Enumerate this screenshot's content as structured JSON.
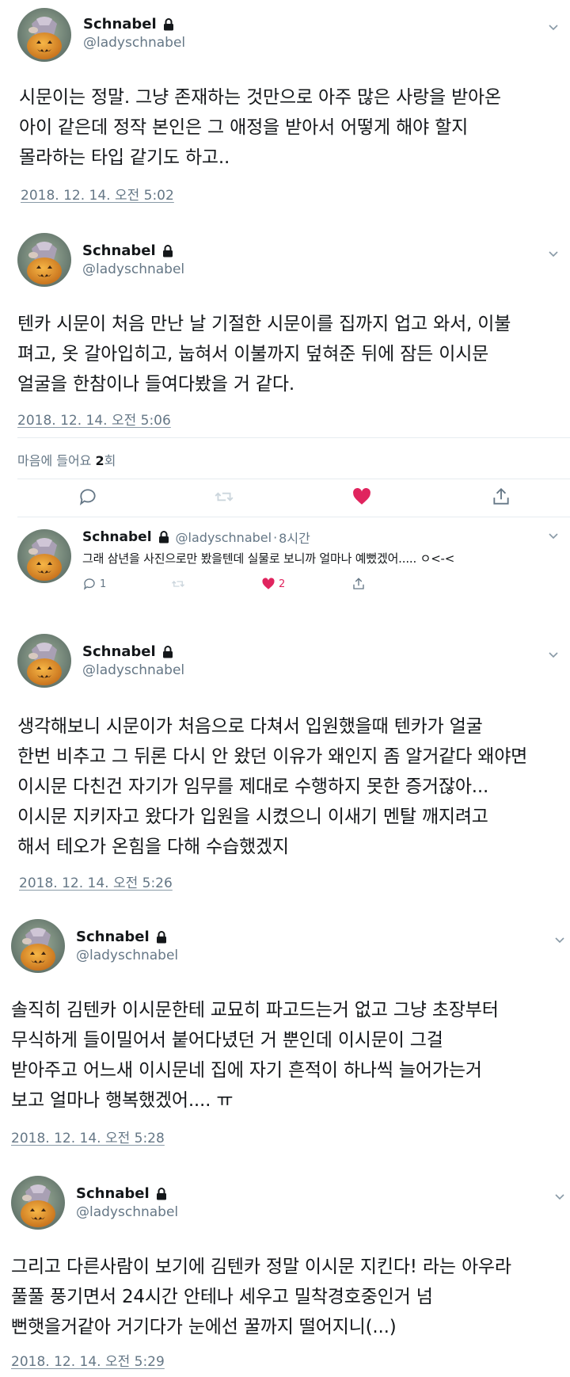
{
  "colors": {
    "text": "#14171a",
    "muted": "#657786",
    "like": "#e0245e",
    "divider": "#e6ecf0"
  },
  "tweets": [
    {
      "name": "Schnabel",
      "handle": "@ladyschnabel",
      "text": "시문이는 정말. 그냥 존재하는 것만으로 아주 많은 사랑을 받아온\n아이 같은데 정작 본인은 그 애정을 받아서 어떻게 해야 할지\n몰라하는 타입 같기도 하고..",
      "timestamp": "2018. 12. 14. 오전 5:02"
    },
    {
      "name": "Schnabel",
      "handle": "@ladyschnabel",
      "text": "텐카 시문이 처음 만난 날 기절한 시문이를 집까지 업고 와서, 이불\n펴고, 옷 갈아입히고, 눕혀서 이불까지 덮혀준 뒤에 잠든 이시문\n얼굴을 한참이나 들여다봤을 거 같다.",
      "timestamp": "2018. 12. 14. 오전 5:06",
      "likes_prefix": "마음에 들어요",
      "likes_count": "2",
      "likes_suffix": "회"
    },
    {
      "name": "Schnabel",
      "handle": "@ladyschnabel",
      "text": "생각해보니 시문이가 처음으로 다쳐서 입원했을때 텐카가 얼굴\n한번 비추고 그 뒤론 다시 안 왔던 이유가 왜인지 좀 알거같다 왜야면\n이시문 다친건 자기가 임무를 제대로 수행하지 못한 증거잖아...\n이시문 지키자고 왔다가 입원을 시켰으니 이새기 멘탈 깨지려고\n해서 테오가 온힘을 다해 수습했겠지",
      "timestamp": "2018. 12. 14. 오전 5:26"
    },
    {
      "name": "Schnabel",
      "handle": "@ladyschnabel",
      "text": "솔직히 김텐카 이시문한테 교묘히 파고드는거 없고 그냥 초장부터\n무식하게 들이밀어서 붙어다녔던 거 뿐인데 이시문이 그걸\n받아주고 어느새 이시문네 집에 자기 흔적이 하나씩 늘어가는거\n보고 얼마나 행복했겠어.... ㅠ",
      "timestamp": "2018. 12. 14. 오전 5:28"
    },
    {
      "name": "Schnabel",
      "handle": "@ladyschnabel",
      "text": "그리고 다른사람이 보기에 김텐카 정말 이시문 지킨다! 라는 아우라\n풀풀 풍기면서 24시간 안테나 세우고 밀착경호중인거 넘\n뻔햇을거같아 거기다가 눈에선 꿀까지 떨어지니(...)",
      "timestamp": "2018. 12. 14. 오전 5:29"
    }
  ],
  "reply": {
    "name": "Schnabel",
    "handle": "@ladyschnabel",
    "time": "8시간",
    "text": "그래 삼년을 사진으로만 봤을텐데 실물로 보니까 얼마나 예뻤겠어..... ㅇ<-<",
    "reply_count": "1",
    "like_count": "2"
  },
  "icons": {
    "action_bar": [
      "reply-icon",
      "retweet-icon",
      "like-filled-icon",
      "share-icon"
    ],
    "lock": "lock-icon",
    "menu": "chevron-down-icon"
  }
}
